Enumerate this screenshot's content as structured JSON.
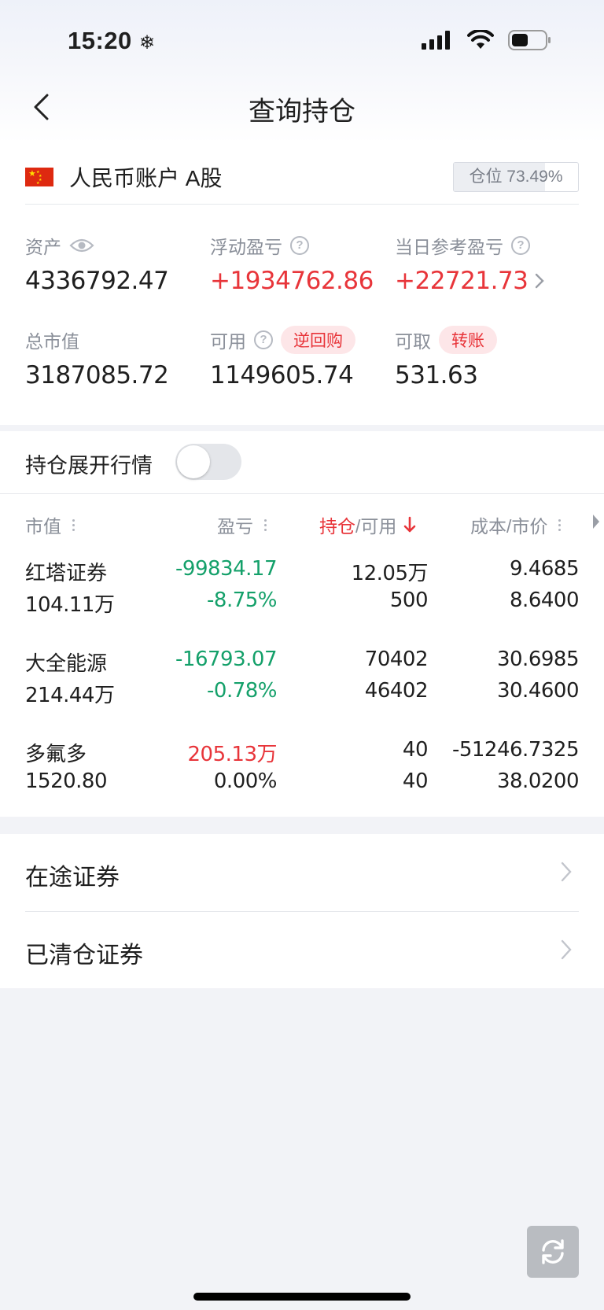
{
  "status": {
    "time": "15:20",
    "time_icon": "snowflake-icon"
  },
  "nav": {
    "title": "查询持仓",
    "back_icon": "chevron-left-icon"
  },
  "account": {
    "name": "人民币账户 A股",
    "flag_icon": "china-flag-icon",
    "position_ratio_label": "仓位 73.49%",
    "position_ratio_value": 73.49
  },
  "metrics": {
    "assets": {
      "label": "资产",
      "value": "4336792.47"
    },
    "floating_pl": {
      "label": "浮动盈亏",
      "value": "+1934762.86"
    },
    "daily_pl": {
      "label": "当日参考盈亏",
      "value": "+22721.73"
    },
    "market_value": {
      "label": "总市值",
      "value": "3187085.72"
    },
    "available": {
      "label": "可用",
      "value": "1149605.74",
      "badge": "逆回购"
    },
    "withdrawable": {
      "label": "可取",
      "value": "531.63",
      "badge": "转账"
    }
  },
  "toggle": {
    "label": "持仓展开行情",
    "on": false
  },
  "table": {
    "headers": {
      "market_value": "市值",
      "pl": "盈亏",
      "holding_a": "持仓",
      "holding_sep": "/",
      "holding_b": "可用",
      "cost_price": "成本/市价"
    },
    "rows": [
      {
        "name": "红塔证券",
        "market_value": "104.11万",
        "pl": "-99834.17",
        "pl_pct": "-8.75%",
        "holding": "12.05万",
        "available": "500",
        "cost": "9.4685",
        "price": "8.6400",
        "pl_color": "green",
        "pct_color": "green"
      },
      {
        "name": "大全能源",
        "market_value": "214.44万",
        "pl": "-16793.07",
        "pl_pct": "-0.78%",
        "holding": "70402",
        "available": "46402",
        "cost": "30.6985",
        "price": "30.4600",
        "pl_color": "green",
        "pct_color": "green"
      },
      {
        "name": "多氟多",
        "market_value": "1520.80",
        "pl": "205.13万",
        "pl_pct": "0.00%",
        "holding": "40",
        "available": "40",
        "cost": "-51246.7325",
        "price": "38.0200",
        "pl_color": "red",
        "pct_color": "black"
      }
    ]
  },
  "links": [
    {
      "label": "在途证券"
    },
    {
      "label": "已清仓证券"
    }
  ],
  "colors": {
    "red": "#e8353a",
    "green": "#14a06a",
    "gray": "#8a8f99"
  }
}
